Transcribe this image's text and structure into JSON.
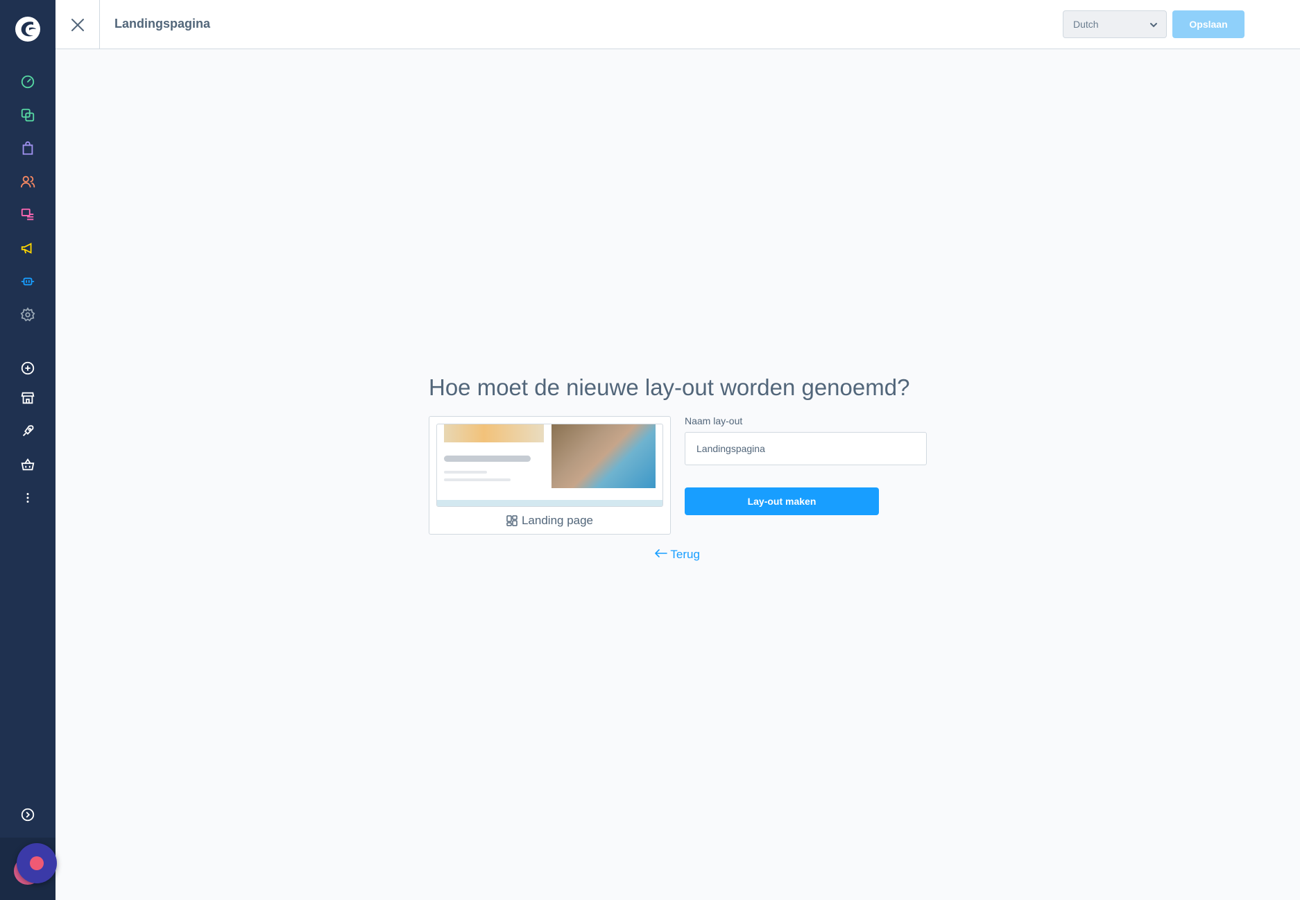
{
  "header": {
    "title": "Landingspagina",
    "language": "Dutch",
    "save_label": "Opslaan"
  },
  "sidebar": {
    "items": [
      {
        "icon": "dashboard-icon",
        "color": "#57d9a3"
      },
      {
        "icon": "catalogues-icon",
        "color": "#57d9a3"
      },
      {
        "icon": "orders-icon",
        "color": "#a092f0"
      },
      {
        "icon": "customers-icon",
        "color": "#f88962"
      },
      {
        "icon": "content-icon",
        "color": "#ff68b4"
      },
      {
        "icon": "marketing-icon",
        "color": "#ffd700"
      },
      {
        "icon": "extensions-icon",
        "color": "#189eff"
      },
      {
        "icon": "settings-icon",
        "color": "#9aa8b5"
      },
      {
        "icon": "add-sales-channel-icon",
        "color": "#ffffff"
      },
      {
        "icon": "storefront-icon",
        "color": "#ffffff"
      },
      {
        "icon": "rocket-icon",
        "color": "#ffffff"
      },
      {
        "icon": "basket-icon",
        "color": "#ffffff"
      },
      {
        "icon": "more-icon",
        "color": "#ffffff"
      },
      {
        "icon": "collapse-icon",
        "color": "#ffffff"
      }
    ]
  },
  "main": {
    "question": "Hoe moet de nieuwe lay-out worden genoemd?",
    "card_label": "Landing page",
    "field_label": "Naam lay-out",
    "field_value": "Landingspagina",
    "create_label": "Lay-out maken",
    "back_label": "Terug"
  },
  "colors": {
    "accent": "#189eff",
    "sidebar_bg": "#1f3150",
    "save_disabled": "#8fd0fa"
  }
}
